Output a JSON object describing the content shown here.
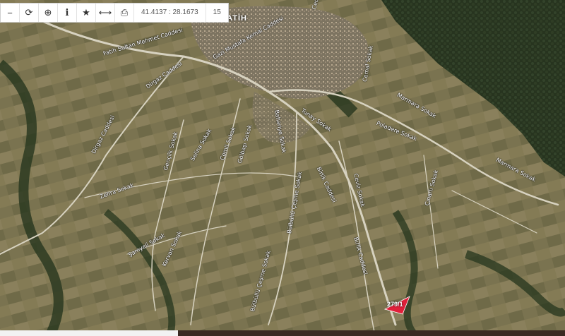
{
  "toolbar": {
    "buttons": [
      {
        "name": "zoom-out-button",
        "icon": "minus-icon",
        "glyph": "−"
      },
      {
        "name": "refresh-button",
        "icon": "refresh-icon",
        "glyph": "⟳"
      },
      {
        "name": "locate-button",
        "icon": "crosshair-icon",
        "glyph": "⊕"
      },
      {
        "name": "info-button",
        "icon": "info-icon",
        "glyph": "i"
      },
      {
        "name": "favorite-button",
        "icon": "star-icon",
        "glyph": "★"
      },
      {
        "name": "measure-button",
        "icon": "measure-icon",
        "glyph": "⟷"
      },
      {
        "name": "print-button",
        "icon": "printer-icon",
        "glyph": "⎙"
      }
    ],
    "coordinates": "41.4137 : 28.1673",
    "zoom_level": "15"
  },
  "map": {
    "place": "FATİH",
    "parcel": "279/1",
    "roads": [
      {
        "name": "Fatih Sultan Mehmet Caddesi",
        "text": "Fatih Sultan Mehmet Caddesi"
      },
      {
        "name": "Gazi Mustafa Kemal Caddesi",
        "text": "Gazi Mustafa Kemal Caddesi"
      },
      {
        "name": "Dirgaz Caddesi north",
        "text": "Dirgaz Caddesi"
      },
      {
        "name": "Dirgaz Caddesi west",
        "text": "Dirgaz Caddesi"
      },
      {
        "name": "Tunay Sokak",
        "text": "Tunay Sokak"
      },
      {
        "name": "Marmara Sokak",
        "text": "Marmara Sokak"
      },
      {
        "name": "Marmara Sokak east",
        "text": "Marmara Sokak"
      },
      {
        "name": "Poladere Sokak",
        "text": "Poladere Sokak"
      },
      {
        "name": "Bahariye Sokak",
        "text": "Bahariye Sokak"
      },
      {
        "name": "Selina Sokak",
        "text": "Selina Sokak"
      },
      {
        "name": "Zehra Sokak",
        "text": "Zehra Sokak"
      },
      {
        "name": "Şamyeli Sokak",
        "text": "Şamyeli Sokak"
      },
      {
        "name": "Birlik Caddesi",
        "text": "Birlik Caddesi"
      },
      {
        "name": "Birlik Caddesi south",
        "text": "Birlik Caddesi"
      },
      {
        "name": "Bülbüllü Çeşme Sokak",
        "text": "Bülbüllü Çeşme Sokak"
      },
      {
        "name": "Bülbüllü Çeşme Sokak south",
        "text": "Bülbüllü Çeşme Sokak"
      },
      {
        "name": "Ceviz Sokak",
        "text": "Ceviz Sokak"
      },
      {
        "name": "Çınarlı Sokak",
        "text": "Çınarlı Sokak"
      },
      {
        "name": "Gençlik Sokak",
        "text": "Gençlik Sokak"
      },
      {
        "name": "Cemil Sokak",
        "text": "Cemil Sokak"
      },
      {
        "name": "Gölbaşı Sokak",
        "text": "Gölbaşı Sokak"
      },
      {
        "name": "Kervan Sokak",
        "text": "Kervan Sokak"
      },
      {
        "name": "Cemal Sokak",
        "text": "Cemal Sokak"
      },
      {
        "name": "Cedde",
        "text": "Cedde"
      }
    ]
  },
  "colors": {
    "forest": "#2c3a22",
    "field": "#7b7450",
    "village": "#8c7f6a",
    "parcel": "#e0203a"
  }
}
